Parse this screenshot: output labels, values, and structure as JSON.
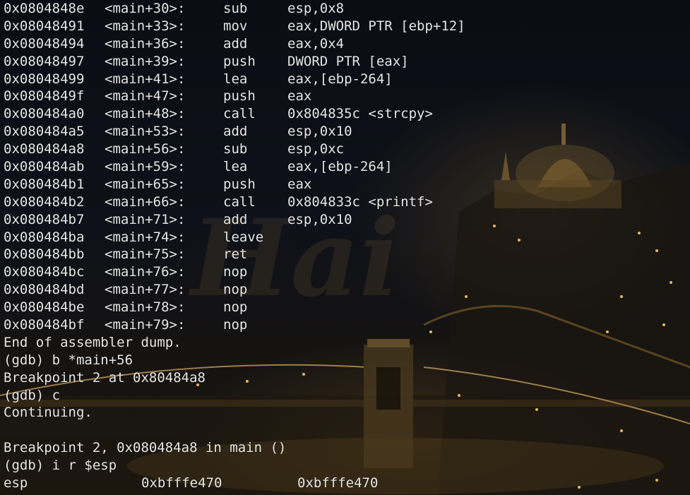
{
  "disassembly": [
    {
      "addr": "0x0804848e",
      "sym": "<main+30>:",
      "op": "sub",
      "args": "esp,0x8"
    },
    {
      "addr": "0x08048491",
      "sym": "<main+33>:",
      "op": "mov",
      "args": "eax,DWORD PTR [ebp+12]"
    },
    {
      "addr": "0x08048494",
      "sym": "<main+36>:",
      "op": "add",
      "args": "eax,0x4"
    },
    {
      "addr": "0x08048497",
      "sym": "<main+39>:",
      "op": "push",
      "args": "DWORD PTR [eax]"
    },
    {
      "addr": "0x08048499",
      "sym": "<main+41>:",
      "op": "lea",
      "args": "eax,[ebp-264]"
    },
    {
      "addr": "0x0804849f",
      "sym": "<main+47>:",
      "op": "push",
      "args": "eax"
    },
    {
      "addr": "0x080484a0",
      "sym": "<main+48>:",
      "op": "call",
      "args": "0x804835c <strcpy>"
    },
    {
      "addr": "0x080484a5",
      "sym": "<main+53>:",
      "op": "add",
      "args": "esp,0x10"
    },
    {
      "addr": "0x080484a8",
      "sym": "<main+56>:",
      "op": "sub",
      "args": "esp,0xc"
    },
    {
      "addr": "0x080484ab",
      "sym": "<main+59>:",
      "op": "lea",
      "args": "eax,[ebp-264]"
    },
    {
      "addr": "0x080484b1",
      "sym": "<main+65>:",
      "op": "push",
      "args": "eax"
    },
    {
      "addr": "0x080484b2",
      "sym": "<main+66>:",
      "op": "call",
      "args": "0x804833c <printf>"
    },
    {
      "addr": "0x080484b7",
      "sym": "<main+71>:",
      "op": "add",
      "args": "esp,0x10"
    },
    {
      "addr": "0x080484ba",
      "sym": "<main+74>:",
      "op": "leave",
      "args": ""
    },
    {
      "addr": "0x080484bb",
      "sym": "<main+75>:",
      "op": "ret",
      "args": ""
    },
    {
      "addr": "0x080484bc",
      "sym": "<main+76>:",
      "op": "nop",
      "args": ""
    },
    {
      "addr": "0x080484bd",
      "sym": "<main+77>:",
      "op": "nop",
      "args": ""
    },
    {
      "addr": "0x080484be",
      "sym": "<main+78>:",
      "op": "nop",
      "args": ""
    },
    {
      "addr": "0x080484bf",
      "sym": "<main+79>:",
      "op": "nop",
      "args": ""
    }
  ],
  "session": [
    "End of assembler dump.",
    "(gdb) b *main+56",
    "Breakpoint 2 at 0x80484a8",
    "(gdb) c",
    "Continuing.",
    "",
    "Breakpoint 2, 0x080484a8 in main ()",
    "(gdb) i r $esp"
  ],
  "register": {
    "name": "esp",
    "hex": "0xbfffe470",
    "value": "0xbfffe470"
  },
  "watermark": "Hai",
  "colors": {
    "text": "#e6e6e6",
    "background": "#0b0e14",
    "city_lights": "#d9a441"
  }
}
